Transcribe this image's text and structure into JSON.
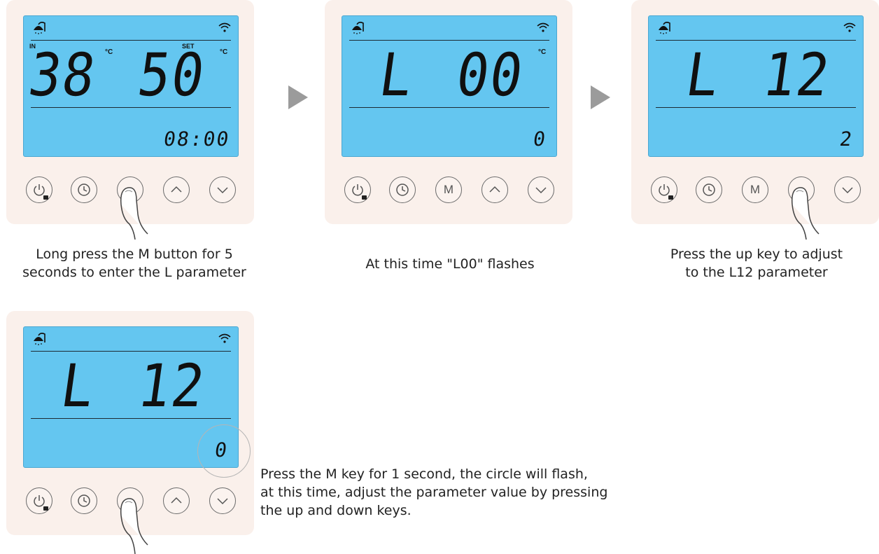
{
  "panels": [
    {
      "in_label": "IN",
      "set_label": "SET",
      "unit_in": "°C",
      "unit_set": "°C",
      "main_left": "38",
      "main_right": "50",
      "bottom_value": "08:00",
      "buttons": [
        "power-lock-icon",
        "clock-icon",
        "M",
        "up-arrow-icon",
        "down-arrow-icon"
      ],
      "caption": "Long press the M button for 5\nseconds to enter the L parameter"
    },
    {
      "unit_set": "°C",
      "main_left": "L",
      "main_right": "00",
      "bottom_value": "0",
      "m_label": "M",
      "caption": "At this time \"L00\" flashes"
    },
    {
      "main_left": "L",
      "main_right": "12",
      "bottom_value": "2",
      "m_label": "M",
      "caption": "Press the up key to adjust\nto the L12 parameter"
    },
    {
      "main_left": "L",
      "main_right": "12",
      "bottom_value": "0",
      "caption": "Press the M key for 1 second, the circle will flash,\nat this time, adjust the parameter value by pressing\nthe up and down keys."
    }
  ],
  "icons": {
    "step_arrow": "right-triangle-icon",
    "status_left": "shower-icon",
    "status_right": "wifi-icon",
    "finger": "pointing-finger-icon"
  },
  "colors": {
    "panel_bg": "#faf0eb",
    "lcd_bg": "#64c6f0",
    "arrow": "#9b9b9b"
  }
}
